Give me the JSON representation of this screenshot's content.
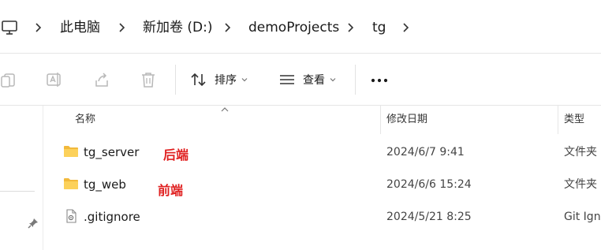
{
  "breadcrumb": {
    "root_icon": "computer-icon",
    "items": [
      "此电脑",
      "新加卷 (D:)",
      "demoProjects",
      "tg"
    ]
  },
  "toolbar": {
    "icons": [
      "copy-icon",
      "rename-icon",
      "share-icon",
      "delete-icon"
    ],
    "sort_label": "排序",
    "view_label": "查看",
    "more_icon": "more-icon"
  },
  "columns": {
    "name": "名称",
    "modified": "修改日期",
    "type": "类型"
  },
  "files": [
    {
      "icon": "folder-icon",
      "name": "tg_server",
      "annotation": "后端",
      "modified": "2024/6/7 9:41",
      "type": "文件夹"
    },
    {
      "icon": "folder-icon",
      "name": "tg_web",
      "annotation": "前端",
      "modified": "2024/6/6 15:24",
      "type": "文件夹"
    },
    {
      "icon": "file-icon",
      "name": ".gitignore",
      "modified": "2024/5/21 8:25",
      "type": "Git Ignore"
    }
  ],
  "colors": {
    "folder": "#f5c242",
    "annotation": "#e02020",
    "icon_disabled": "#b8b8b8"
  }
}
